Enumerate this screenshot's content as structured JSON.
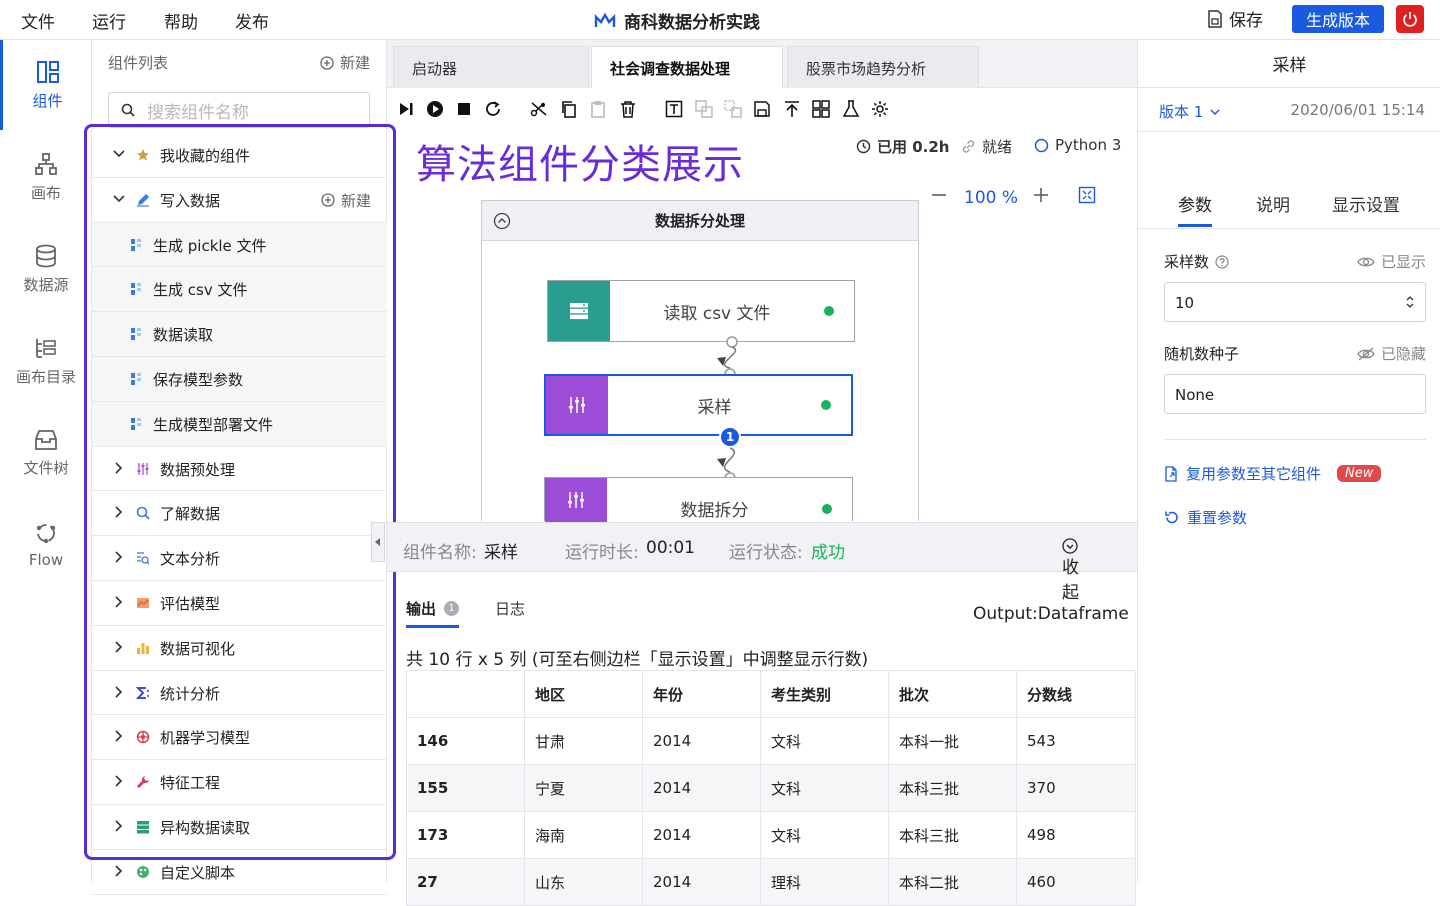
{
  "menu": [
    "文件",
    "运行",
    "帮助",
    "发布"
  ],
  "app_title": "商科数据分析实践",
  "save_label": "保存",
  "generate_label": "生成版本",
  "rail": [
    {
      "label": "组件",
      "icon": "component-icon",
      "active": true
    },
    {
      "label": "画布",
      "icon": "canvas-icon",
      "active": false
    },
    {
      "label": "数据源",
      "icon": "database-icon",
      "active": false
    },
    {
      "label": "画布目录",
      "icon": "catalog-icon",
      "active": false
    },
    {
      "label": "文件树",
      "icon": "file-tree-icon",
      "active": false
    },
    {
      "label": "Flow",
      "icon": "flow-icon",
      "active": false
    }
  ],
  "components": {
    "title": "组件列表",
    "new_label": "新建",
    "search_placeholder": "搜索组件名称",
    "favorites": "我收藏的组件",
    "write_data": "写入数据",
    "write_children": [
      "生成 pickle 文件",
      "生成 csv 文件",
      "数据读取",
      "保存模型参数",
      "生成模型部署文件"
    ],
    "categories": [
      "数据预处理",
      "了解数据",
      "文本分析",
      "评估模型",
      "数据可视化",
      "统计分析",
      "机器学习模型",
      "特征工程",
      "异构数据读取",
      "自定义脚本"
    ]
  },
  "annotation": "算法组件分类展示",
  "tabs": [
    "启动器",
    "社会调查数据处理",
    "股票市场趋势分析"
  ],
  "status": {
    "used": "已用 0.2h",
    "ready": "就绪",
    "python": "Python 3"
  },
  "zoom": "100 %",
  "canvas": {
    "group_title": "数据拆分处理",
    "nodes": [
      "读取 csv 文件",
      "采样",
      "数据拆分"
    ],
    "badge": "1"
  },
  "run": {
    "name_label": "组件名称:",
    "name_value": "采样",
    "time_label": "运行时长:",
    "time_value": "00:01",
    "state_label": "运行状态:",
    "state_value": "成功",
    "collapse": "收起"
  },
  "output": {
    "tab_output": "输出",
    "tab_output_badge": "1",
    "tab_log": "日志",
    "type": "Output:Dataframe",
    "summary": "共 10 行 x 5 列 (可至右侧边栏「显示设置」中调整显示行数)",
    "columns": [
      "",
      "地区",
      "年份",
      "考生类别",
      "批次",
      "分数线"
    ],
    "rows": [
      [
        "146",
        "甘肃",
        "2014",
        "文科",
        "本科一批",
        "543"
      ],
      [
        "155",
        "宁夏",
        "2014",
        "文科",
        "本科三批",
        "370"
      ],
      [
        "173",
        "海南",
        "2014",
        "文科",
        "本科三批",
        "498"
      ],
      [
        "27",
        "山东",
        "2014",
        "理科",
        "本科二批",
        "460"
      ]
    ]
  },
  "right": {
    "title": "采样",
    "version": "版本 1",
    "date": "2020/06/01 15:14",
    "tabs": [
      "参数",
      "说明",
      "显示设置"
    ],
    "field1_label": "采样数",
    "field1_state": "已显示",
    "field1_value": "10",
    "field2_label": "随机数种子",
    "field2_state": "已隐藏",
    "field2_value": "None",
    "reuse": "复用参数至其它组件",
    "new_badge": "New",
    "reset": "重置参数"
  },
  "colors": {
    "accent": "#1a5ae0",
    "node_csv": "#2a9d8f",
    "node_sample": "#9b4dd8",
    "annotation": "#6a2bd8",
    "success": "#19b35a"
  }
}
